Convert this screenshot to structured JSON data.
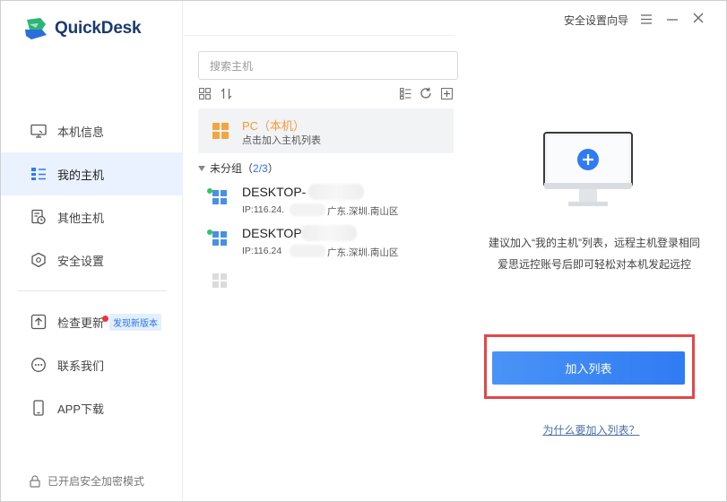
{
  "app": {
    "name": "QuickDesk"
  },
  "titlebar": {
    "wizard": "安全设置向导"
  },
  "sidebar": {
    "items": [
      {
        "label": "本机信息"
      },
      {
        "label": "我的主机"
      },
      {
        "label": "其他主机"
      },
      {
        "label": "安全设置"
      },
      {
        "label": "检查更新",
        "badge": "发现新版本"
      },
      {
        "label": "联系我们"
      },
      {
        "label": "APP下载"
      }
    ],
    "secure_mode": "已开启安全加密模式"
  },
  "search": {
    "placeholder": "搜索主机"
  },
  "local_pc": {
    "title": "PC（本机）",
    "subtitle": "点击加入主机列表"
  },
  "group": {
    "name": "未分组",
    "count_open": "（",
    "count": "2/3",
    "count_close": "）"
  },
  "hosts": [
    {
      "name": "DESKTOP-",
      "ip": "IP:116.24.",
      "location": "广东.深圳.南山区"
    },
    {
      "name": "DESKTOP",
      "ip": "IP:116.24",
      "location": "广东.深圳.南山区"
    }
  ],
  "right": {
    "desc_line1": "建议加入“我的主机”列表，远程主机登录相同",
    "desc_line2": "爱思远控账号后即可轻松对本机发起远控",
    "add_button": "加入列表",
    "why_link": "为什么要加入列表？"
  },
  "colors": {
    "accent": "#2f7bf3",
    "orange": "#f29b38",
    "online": "#2ec46a",
    "highlight": "#e04848"
  }
}
